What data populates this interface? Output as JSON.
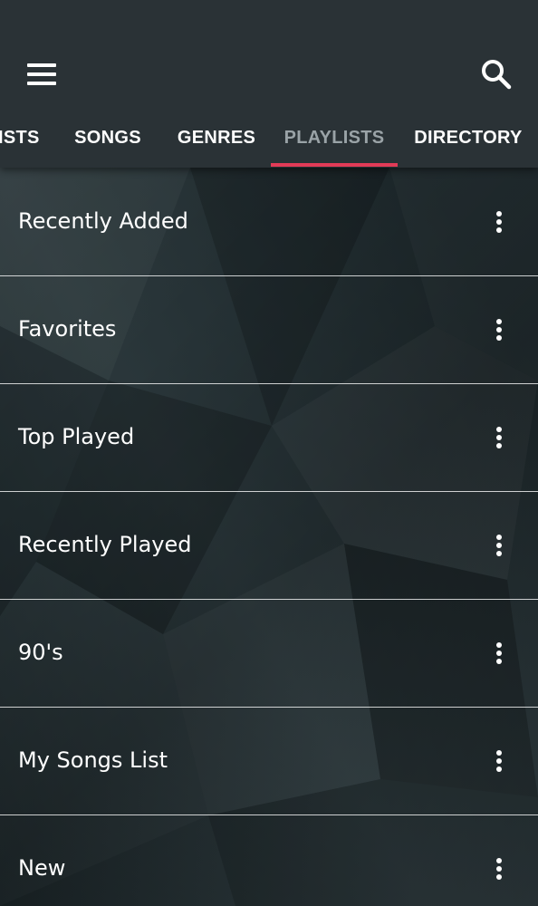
{
  "header": {
    "menu_icon": "hamburger-menu-icon",
    "search_icon": "search-icon"
  },
  "tabs": [
    {
      "label": "ISTS",
      "active": false
    },
    {
      "label": "SONGS",
      "active": false
    },
    {
      "label": "GENRES",
      "active": false
    },
    {
      "label": "PLAYLISTS",
      "active": true
    },
    {
      "label": "DIRECTORY",
      "active": false
    }
  ],
  "playlists": [
    {
      "label": "Recently Added"
    },
    {
      "label": "Favorites"
    },
    {
      "label": "Top Played"
    },
    {
      "label": "Recently Played"
    },
    {
      "label": "90's"
    },
    {
      "label": "My Songs List"
    },
    {
      "label": "New"
    }
  ],
  "colors": {
    "appbar": "#2a3236",
    "indicator": "#e23b57",
    "active_tab_text": "#9aa3a7",
    "text": "#ffffff"
  },
  "row_menu_icon": "more-vertical-icon"
}
